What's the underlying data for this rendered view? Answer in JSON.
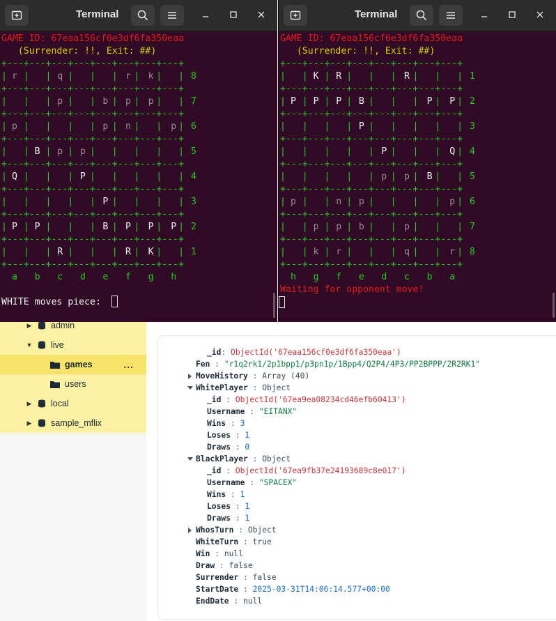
{
  "terminals": [
    {
      "id": "white",
      "title": "Terminal",
      "game_id_line": "GAME ID: 67eaa156cf0e3df6fa350eaa",
      "commands_line": "   (Surrender: !!, Exit: ##)",
      "files": [
        "a",
        "b",
        "c",
        "d",
        "e",
        "f",
        "g",
        "h"
      ],
      "ranks": [
        "8",
        "7",
        "6",
        "5",
        "4",
        "3",
        "2",
        "1"
      ],
      "board": [
        [
          "r",
          "",
          "q",
          "",
          "",
          "r",
          "k",
          ""
        ],
        [
          "",
          "",
          "p",
          "",
          "b",
          "p",
          "p",
          ""
        ],
        [
          "p",
          "",
          "",
          "",
          "p",
          "n",
          "",
          "p"
        ],
        [
          "",
          "B",
          "p",
          "p",
          "",
          "",
          "",
          ""
        ],
        [
          "Q",
          "",
          "",
          "P",
          "",
          "",
          "",
          ""
        ],
        [
          "",
          "",
          "",
          "",
          "P",
          "",
          "",
          ""
        ],
        [
          "P",
          "P",
          "",
          "",
          "B",
          "P",
          "P",
          "P"
        ],
        [
          "",
          "",
          "R",
          "",
          "",
          "R",
          "K",
          ""
        ]
      ],
      "prompt": "WHITE moves piece: ",
      "status": ""
    },
    {
      "id": "black",
      "title": "Terminal",
      "game_id_line": "GAME ID: 67eaa156cf0e3df6fa350eaa",
      "commands_line": "   (Surrender: !!, Exit: ##)",
      "files": [
        "h",
        "g",
        "f",
        "e",
        "d",
        "c",
        "b",
        "a"
      ],
      "ranks": [
        "1",
        "2",
        "3",
        "4",
        "5",
        "6",
        "7",
        "8"
      ],
      "board": [
        [
          "",
          "K",
          "R",
          "",
          "",
          "R",
          "",
          ""
        ],
        [
          "P",
          "P",
          "P",
          "B",
          "",
          "",
          "P",
          "P"
        ],
        [
          "",
          "",
          "",
          "P",
          "",
          "",
          "",
          ""
        ],
        [
          "",
          "",
          "",
          "",
          "P",
          "",
          "",
          "Q"
        ],
        [
          "",
          "",
          "",
          "",
          "p",
          "p",
          "B",
          ""
        ],
        [
          "p",
          "",
          "n",
          "p",
          "",
          "",
          "",
          "p"
        ],
        [
          "",
          "p",
          "p",
          "b",
          "",
          "p",
          "",
          ""
        ],
        [
          "",
          "k",
          "r",
          "",
          "",
          "q",
          "",
          "r"
        ]
      ],
      "prompt": "",
      "status": "Waiting for opponent move!"
    }
  ],
  "board_border": "+---+---+---+---+---+---+---+---+",
  "db_tree": {
    "items": [
      {
        "label": "admin",
        "type": "database",
        "expanded": false
      },
      {
        "label": "live",
        "type": "database",
        "expanded": true
      },
      {
        "label": "games",
        "type": "collection",
        "selected": true
      },
      {
        "label": "users",
        "type": "collection"
      },
      {
        "label": "local",
        "type": "database",
        "expanded": false
      },
      {
        "label": "sample_mflix",
        "type": "database",
        "expanded": false
      }
    ],
    "more_label": "..."
  },
  "document": {
    "id_key": "_id",
    "id_val": "ObjectId('67eaa156cf0e3df6fa350eaa')",
    "fen_key": "Fen",
    "fen_val": "\"r1q2rk1/2p1bpp1/p3pn1p/1Bpp4/Q2P4/4P3/PP2BPPP/2R2RK1\"",
    "movehistory_key": "MoveHistory",
    "movehistory_val": "Array (40)",
    "white_key": "WhitePlayer",
    "white_val": "Object",
    "white": {
      "id_key": "_id",
      "id_val": "ObjectId('67ea9ea08234cd46efb60413')",
      "username_key": "Username",
      "username_val": "\"EITANX\"",
      "wins_key": "Wins",
      "wins_val": "3",
      "loses_key": "Loses",
      "loses_val": "1",
      "draws_key": "Draws",
      "draws_val": "0"
    },
    "black_key": "BlackPlayer",
    "black_val": "Object",
    "black": {
      "id_key": "_id",
      "id_val": "ObjectId('67ea9fb37e24193689c8e017')",
      "username_key": "Username",
      "username_val": "\"SPACEX\"",
      "wins_key": "Wins",
      "wins_val": "1",
      "loses_key": "Loses",
      "loses_val": "1",
      "draws_key": "Draws",
      "draws_val": "1"
    },
    "whosturn_key": "WhosTurn",
    "whosturn_val": "Object",
    "whiteturn_key": "WhiteTurn",
    "whiteturn_val": "true",
    "win_key": "Win",
    "win_val": "null",
    "draw_key": "Draw",
    "draw_val": "false",
    "surrender_key": "Surrender",
    "surrender_val": "false",
    "startdate_key": "StartDate",
    "startdate_val": "2025-03-31T14:06:14.577+00:00",
    "enddate_key": "EndDate",
    "enddate_val": "null"
  },
  "colors": {
    "terminal_bg": "#300a24",
    "game_id": "#e01b1b",
    "commands": "#d6d000",
    "grid": "#26c926",
    "sidebar": "#fdf2a3",
    "oid": "#c4383b",
    "string": "#0f7b43",
    "number": "#1a6ec6"
  }
}
